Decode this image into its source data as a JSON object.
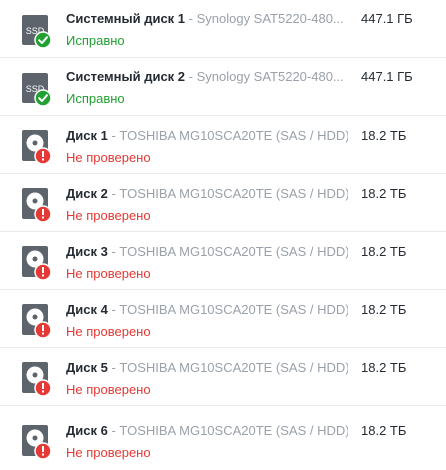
{
  "drives": [
    {
      "kind": "ssd",
      "icon": "ssd-healthy-icon",
      "name": "Системный диск 1",
      "model": " - Synology SAT5220-480...",
      "size": "447.1 ГБ",
      "status": "Исправно",
      "status_type": "ok",
      "ssd_label": "SSD"
    },
    {
      "kind": "ssd",
      "icon": "ssd-healthy-icon",
      "name": "Системный диск 2",
      "model": " - Synology SAT5220-480...",
      "size": "447.1 ГБ",
      "status": "Исправно",
      "status_type": "ok",
      "ssd_label": "SSD"
    },
    {
      "kind": "hdd",
      "icon": "hdd-warning-icon",
      "name": "Диск 1",
      "model": " - TOSHIBA MG10SCA20TE (SAS / HDD)",
      "size": "18.2 ТБ",
      "status": "Не проверено",
      "status_type": "warn"
    },
    {
      "kind": "hdd",
      "icon": "hdd-warning-icon",
      "name": "Диск 2",
      "model": " - TOSHIBA MG10SCA20TE (SAS / HDD)",
      "size": "18.2 ТБ",
      "status": "Не проверено",
      "status_type": "warn"
    },
    {
      "kind": "hdd",
      "icon": "hdd-warning-icon",
      "name": "Диск 3",
      "model": " - TOSHIBA MG10SCA20TE (SAS / HDD)",
      "size": "18.2 ТБ",
      "status": "Не проверено",
      "status_type": "warn"
    },
    {
      "kind": "hdd",
      "icon": "hdd-warning-icon",
      "name": "Диск 4",
      "model": " - TOSHIBA MG10SCA20TE (SAS / HDD)",
      "size": "18.2 ТБ",
      "status": "Не проверено",
      "status_type": "warn"
    },
    {
      "kind": "hdd",
      "icon": "hdd-warning-icon",
      "name": "Диск 5",
      "model": " - TOSHIBA MG10SCA20TE (SAS / HDD)",
      "size": "18.2 ТБ",
      "status": "Не проверено",
      "status_type": "warn"
    },
    {
      "kind": "hdd",
      "icon": "hdd-warning-icon",
      "name": "Диск 6",
      "model": " - TOSHIBA MG10SCA20TE (SAS / HDD)",
      "size": "18.2 ТБ",
      "status": "Не проверено",
      "status_type": "warn"
    }
  ],
  "colors": {
    "ok": "#21a131",
    "warn": "#e53935",
    "icon_body": "#5e646c",
    "text_primary": "#252b33",
    "text_secondary": "#9aa1a9"
  }
}
